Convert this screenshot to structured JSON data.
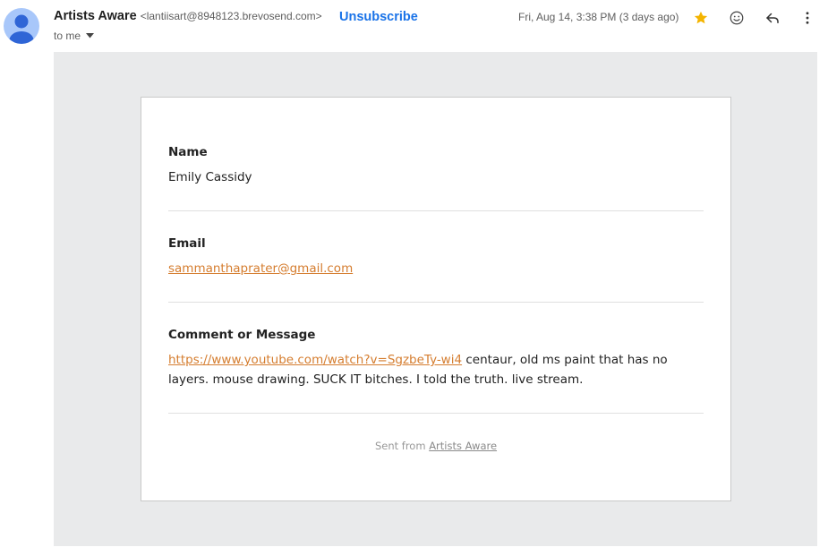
{
  "header": {
    "sender_name": "Artists Aware",
    "sender_email": "<lantiisart@8948123.brevosend.com>",
    "unsubscribe_label": "Unsubscribe",
    "to_label": "to me",
    "date": "Fri, Aug 14, 3:38 PM (3 days ago)",
    "icons": [
      "star-icon",
      "emoji-icon",
      "reply-icon",
      "more-vert-icon"
    ],
    "star_color": "#f4b400"
  },
  "form": {
    "name_label": "Name",
    "name_value": "Emily Cassidy",
    "email_label": "Email",
    "email_value": "sammanthaprater@gmail.com",
    "message_label": "Comment or Message",
    "message_link": "https://www.youtube.com/watch?v=SgzbeTy-wi4",
    "message_text": " centaur, old ms paint that has no layers. mouse drawing. SUCK IT bitches. I told the truth. live stream.",
    "link_color": "#d57d2f"
  },
  "footer": {
    "prefix": "Sent from ",
    "link_text": "Artists Aware"
  }
}
